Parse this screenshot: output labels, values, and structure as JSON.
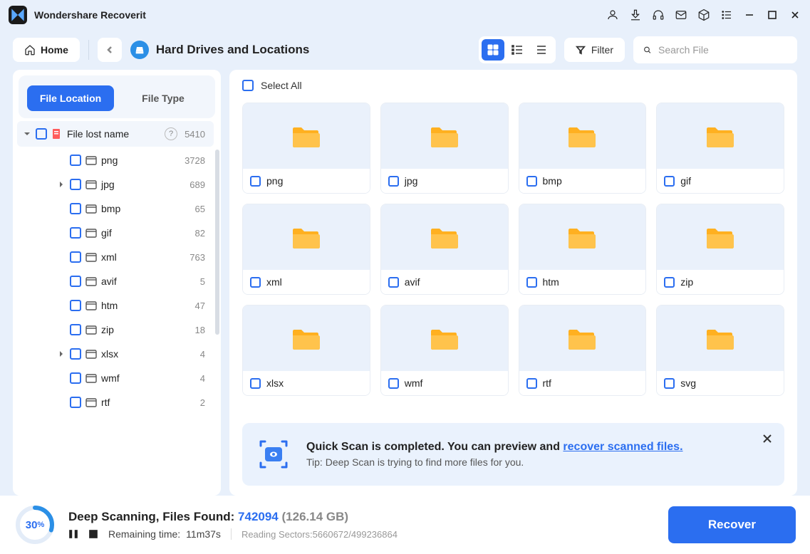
{
  "app": {
    "title": "Wondershare Recoverit"
  },
  "toolbar": {
    "home": "Home",
    "breadcrumb": "Hard Drives and Locations",
    "filter": "Filter",
    "search_placeholder": "Search File"
  },
  "sidebar": {
    "tabs": {
      "location": "File Location",
      "type": "File Type"
    },
    "root": {
      "label": "File lost name",
      "count": "5410"
    },
    "items": [
      {
        "label": "png",
        "count": "3728",
        "expandable": false
      },
      {
        "label": "jpg",
        "count": "689",
        "expandable": true
      },
      {
        "label": "bmp",
        "count": "65",
        "expandable": false
      },
      {
        "label": "gif",
        "count": "82",
        "expandable": false
      },
      {
        "label": "xml",
        "count": "763",
        "expandable": false
      },
      {
        "label": "avif",
        "count": "5",
        "expandable": false
      },
      {
        "label": "htm",
        "count": "47",
        "expandable": false
      },
      {
        "label": "zip",
        "count": "18",
        "expandable": false
      },
      {
        "label": "xlsx",
        "count": "4",
        "expandable": true
      },
      {
        "label": "wmf",
        "count": "4",
        "expandable": false
      },
      {
        "label": "rtf",
        "count": "2",
        "expandable": false
      }
    ]
  },
  "content": {
    "select_all": "Select All",
    "folders": [
      "png",
      "jpg",
      "bmp",
      "gif",
      "xml",
      "avif",
      "htm",
      "zip",
      "xlsx",
      "wmf",
      "rtf",
      "svg"
    ]
  },
  "notify": {
    "title_pre": "Quick Scan is completed. You can preview and ",
    "title_link": "recover scanned files.",
    "tip": "Tip: Deep Scan is trying to find more files for you."
  },
  "status": {
    "percent": "30",
    "label": "Deep Scanning, Files Found: ",
    "found": "742094",
    "size": "(126.14 GB)",
    "remaining_label": "Remaining time:",
    "remaining_value": "11m37s",
    "sectors": "Reading Sectors:5660672/499236864",
    "recover": "Recover"
  }
}
